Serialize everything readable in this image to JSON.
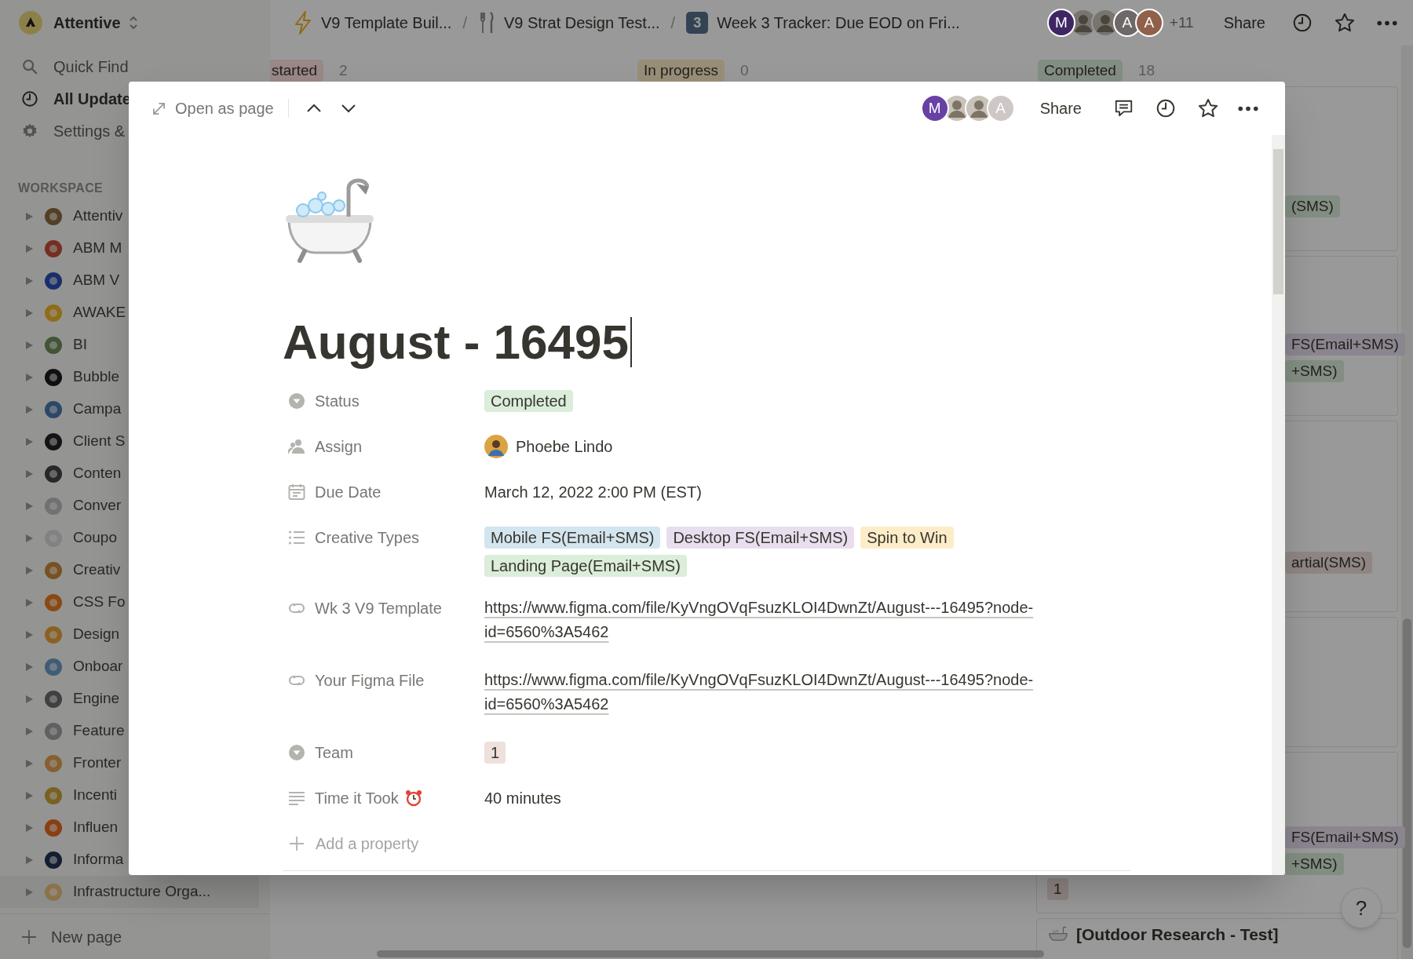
{
  "workspace": {
    "name": "Attentive"
  },
  "sidebar": {
    "nav": [
      {
        "label": "Quick Find",
        "kind": "search"
      },
      {
        "label": "All Update",
        "kind": "updates"
      },
      {
        "label": "Settings &",
        "kind": "settings"
      }
    ],
    "section_title": "WORKSPACE",
    "pages": [
      {
        "label": "Attentiv",
        "selected": false
      },
      {
        "label": "ABM M",
        "selected": false
      },
      {
        "label": "ABM V",
        "selected": false
      },
      {
        "label": "AWAKE",
        "selected": false
      },
      {
        "label": "BI",
        "selected": false
      },
      {
        "label": "Bubble",
        "selected": false
      },
      {
        "label": "Campa",
        "selected": false
      },
      {
        "label": "Client S",
        "selected": false
      },
      {
        "label": "Conten",
        "selected": false
      },
      {
        "label": "Conver",
        "selected": false
      },
      {
        "label": "Coupo",
        "selected": false
      },
      {
        "label": "Creativ",
        "selected": false
      },
      {
        "label": "CSS Fo",
        "selected": false
      },
      {
        "label": "Design",
        "selected": false
      },
      {
        "label": "Onboar",
        "selected": false
      },
      {
        "label": "Engine",
        "selected": false
      },
      {
        "label": "Feature",
        "selected": false
      },
      {
        "label": "Fronter",
        "selected": false
      },
      {
        "label": "Incenti",
        "selected": false
      },
      {
        "label": "Influen",
        "selected": false
      },
      {
        "label": "Informa",
        "selected": false
      },
      {
        "label": "Infrastructure Orga...",
        "selected": true
      }
    ],
    "new_page": "New page"
  },
  "breadcrumbs": [
    {
      "label": "V9 Template Buil...",
      "kind": "bolt"
    },
    {
      "separator": "/",
      "label": "V9 Strat Design Test...",
      "kind": "fork"
    },
    {
      "separator": "/",
      "label": "Week 3 Tracker: Due EOD on Fri...",
      "kind": "keycap",
      "icon_text": "3"
    }
  ],
  "topbar": {
    "avatars": [
      {
        "kind": "letter",
        "initial": "M",
        "color": "#3f2663"
      },
      {
        "kind": "photo"
      },
      {
        "kind": "photo"
      },
      {
        "kind": "letter",
        "initial": "A",
        "color": "#6f6868"
      },
      {
        "kind": "letter",
        "initial": "A",
        "color": "#90604a"
      }
    ],
    "more_count": "+11",
    "share": "Share"
  },
  "board": {
    "columns": [
      {
        "label": "started",
        "count": "2",
        "color": "#998885"
      },
      {
        "label": "In progress",
        "count": "0",
        "color": "#988e78"
      },
      {
        "label": "Completed",
        "count": "18",
        "color": "#838e83"
      }
    ],
    "cards": [
      {
        "kind": "tags",
        "tags": [
          {
            "text": "(SMS)",
            "color": "#838e83"
          }
        ]
      },
      {
        "kind": "tags",
        "tags": [
          {
            "text": "FS(Email+SMS)",
            "color": "#8b858f"
          },
          {
            "text": "+SMS)",
            "color": "#838e83"
          }
        ]
      },
      {
        "kind": "tags",
        "tags": [
          {
            "text": "artial(SMS)",
            "color": "#8f8683"
          }
        ]
      },
      {
        "kind": "blank"
      },
      {
        "kind": "tags",
        "tags": [
          {
            "text": "FS(Email+SMS)",
            "color": "#8b858f"
          },
          {
            "text": "+SMS)",
            "color": "#838e83"
          }
        ],
        "team_tag": {
          "text": "1",
          "color": "#8f8683"
        }
      },
      {
        "kind": "titled",
        "title": "[Outdoor Research - Test]"
      }
    ],
    "help": "?"
  },
  "modal": {
    "open_as_page": "Open as page",
    "avatars": [
      {
        "kind": "letter",
        "initial": "M",
        "color": "#6940a5"
      },
      {
        "kind": "photo"
      },
      {
        "kind": "photo"
      },
      {
        "kind": "letter",
        "initial": "A",
        "color": "#cfc6c6"
      }
    ],
    "share": "Share",
    "title": "August - 16495",
    "properties": [
      {
        "label": "Status",
        "kind": "tags",
        "tags": [
          {
            "text": "Completed",
            "color": "#dbeddb"
          }
        ]
      },
      {
        "label": "Assign",
        "kind": "person",
        "value": "Phoebe Lindo"
      },
      {
        "label": "Due Date",
        "kind": "text",
        "value": "March 12, 2022 2:00 PM (EST)"
      },
      {
        "label": "Creative Types",
        "kind": "tags",
        "tags": [
          {
            "text": "Mobile FS(Email+SMS)",
            "color": "#d3e5ef"
          },
          {
            "text": "Desktop FS(Email+SMS)",
            "color": "#e8deee"
          },
          {
            "text": "Spin to Win",
            "color": "#fdecc8"
          },
          {
            "text": "Landing Page(Email+SMS)",
            "color": "#dbeddb"
          }
        ]
      },
      {
        "label": "Wk 3 V9 Template",
        "kind": "url",
        "value": "https://www.figma.com/file/KyVngOVqFsuzKLOI4DwnZt/August---16495?node-id=6560%3A5462"
      },
      {
        "label": "Your Figma File",
        "kind": "url",
        "value": "https://www.figma.com/file/KyVngOVqFsuzKLOI4DwnZt/August---16495?node-id=6560%3A5462"
      },
      {
        "label": "Team",
        "kind": "tags",
        "tags": [
          {
            "text": "1",
            "color": "#eee0da"
          }
        ]
      },
      {
        "label": "Time it Took",
        "kind": "text",
        "value": "40 minutes"
      }
    ],
    "add_property": "Add a property"
  }
}
